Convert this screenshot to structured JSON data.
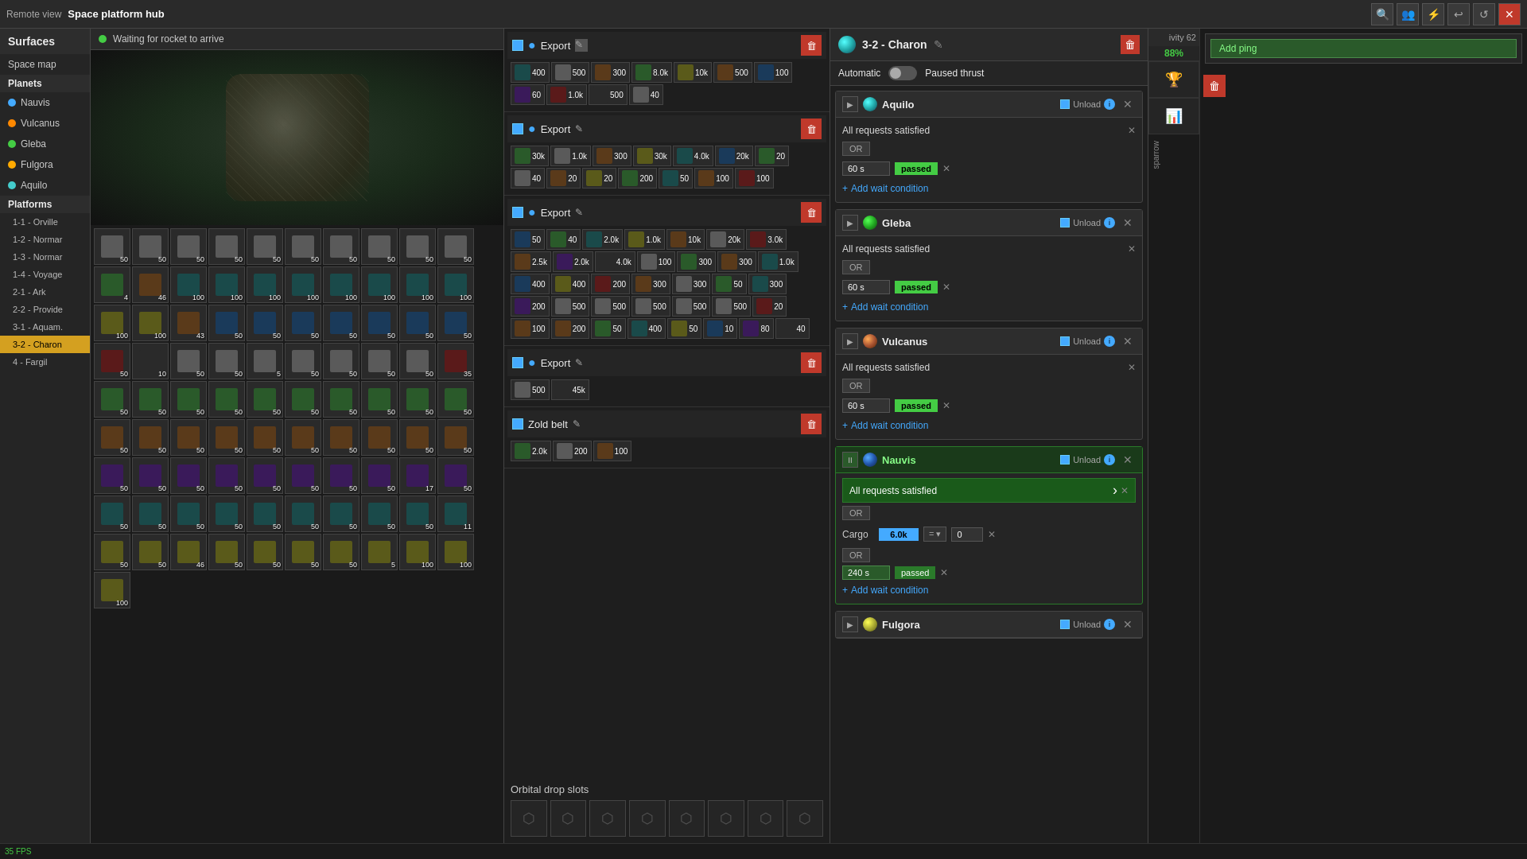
{
  "titleBar": {
    "remoteView": "Remote view",
    "title": "Space platform hub",
    "icons": [
      "🔍",
      "👥",
      "⚡",
      "↩",
      "✕"
    ]
  },
  "leftSidebar": {
    "surfacesLabel": "Surfaces",
    "spaceMapLabel": "Space map",
    "planetsLabel": "Planets",
    "planets": [
      {
        "name": "Nauvis",
        "dotClass": "dot-blue"
      },
      {
        "name": "Vulcanus",
        "dotClass": "dot-orange"
      },
      {
        "name": "Gleba",
        "dotClass": "dot-green"
      },
      {
        "name": "Fulgora",
        "dotClass": "dot-yellow"
      },
      {
        "name": "Aquilo",
        "dotClass": "dot-teal"
      }
    ],
    "platformsLabel": "Platforms",
    "platforms": [
      {
        "name": "1-1 - Orville",
        "active": false
      },
      {
        "name": "1-2 - Normar",
        "active": false
      },
      {
        "name": "1-3 - Normar",
        "active": false
      },
      {
        "name": "1-4 - Voyage",
        "active": false
      },
      {
        "name": "2-1 - Ark",
        "active": false
      },
      {
        "name": "2-2 - Provide",
        "active": false
      },
      {
        "name": "3-1 - Aquam.",
        "active": false
      },
      {
        "name": "3-2 - Charon",
        "active": true
      },
      {
        "name": "4 - Fargil",
        "active": false
      }
    ]
  },
  "gameView": {
    "waitingStatus": "Waiting for rocket to arrive"
  },
  "exportPanel": {
    "exports": [
      {
        "label": "Export",
        "items": [
          {
            "count": "400"
          },
          {
            "count": "500"
          },
          {
            "count": "300"
          },
          {
            "count": "8.0k"
          },
          {
            "count": "10k"
          },
          {
            "count": "500"
          },
          {
            "count": "100"
          },
          {
            "count": "60"
          },
          {
            "count": "1.0k"
          },
          {
            "count": "500"
          },
          {
            "count": "40"
          }
        ]
      },
      {
        "label": "Export",
        "items": [
          {
            "count": "30k"
          },
          {
            "count": "1.0k"
          },
          {
            "count": "300"
          },
          {
            "count": "30k"
          },
          {
            "count": "4.0k"
          },
          {
            "count": "20k"
          },
          {
            "count": "20"
          },
          {
            "count": "40"
          },
          {
            "count": "20"
          },
          {
            "count": "20"
          },
          {
            "count": "200"
          },
          {
            "count": "50"
          },
          {
            "count": "100"
          },
          {
            "count": "100"
          }
        ]
      },
      {
        "label": "Export",
        "items": [
          {
            "count": "50"
          },
          {
            "count": "40"
          },
          {
            "count": "2.0k"
          },
          {
            "count": "1.0k"
          },
          {
            "count": "10k"
          },
          {
            "count": "20k"
          },
          {
            "count": "3.0k"
          },
          {
            "count": "2.5k"
          },
          {
            "count": "2.0k"
          },
          {
            "count": "4.0k"
          },
          {
            "count": "100"
          },
          {
            "count": "300"
          },
          {
            "count": "300"
          },
          {
            "count": "1.0k"
          },
          {
            "count": "400"
          },
          {
            "count": "400"
          },
          {
            "count": "200"
          },
          {
            "count": "300"
          },
          {
            "count": "300"
          },
          {
            "count": "50"
          },
          {
            "count": "300"
          },
          {
            "count": "200"
          },
          {
            "count": "500"
          },
          {
            "count": "500"
          },
          {
            "count": "500"
          },
          {
            "count": "500"
          },
          {
            "count": "500"
          },
          {
            "count": "20"
          },
          {
            "count": "100"
          },
          {
            "count": "200"
          },
          {
            "count": "50"
          },
          {
            "count": "400"
          },
          {
            "count": "50"
          },
          {
            "count": "10"
          },
          {
            "count": "80"
          },
          {
            "count": "40"
          }
        ]
      },
      {
        "label": "Export",
        "items": [
          {
            "count": "500"
          },
          {
            "count": "45k"
          }
        ]
      },
      {
        "label": "Zold belt",
        "items": [
          {
            "count": "2.0k"
          },
          {
            "count": "200"
          },
          {
            "count": "100"
          }
        ]
      }
    ],
    "orbitalSlotsLabel": "Orbital drop slots"
  },
  "schedule": {
    "title": "3-2 - Charon",
    "autoLabel": "Automatic",
    "pausedLabel": "Paused thrust",
    "stops": [
      {
        "name": "Aquilo",
        "unloadLabel": "Unload",
        "conditions": [
          {
            "type": "allRequests",
            "label": "All requests satisfied"
          },
          {
            "type": "time",
            "seconds": "60 s",
            "status": "passed"
          }
        ],
        "addWaitLabel": "+ Add wait condition"
      },
      {
        "name": "Gleba",
        "unloadLabel": "Unload",
        "conditions": [
          {
            "type": "allRequests",
            "label": "All requests satisfied"
          },
          {
            "type": "time",
            "seconds": "60 s",
            "status": "passed"
          }
        ],
        "addWaitLabel": "+ Add wait condition"
      },
      {
        "name": "Vulcanus",
        "unloadLabel": "Unload",
        "conditions": [
          {
            "type": "allRequests",
            "label": "All requests satisfied"
          },
          {
            "type": "time",
            "seconds": "60 s",
            "status": "passed"
          }
        ],
        "addWaitLabel": "+ Add wait condition"
      },
      {
        "name": "Nauvis",
        "unloadLabel": "Unload",
        "active": true,
        "conditions": [
          {
            "type": "allRequestsActive",
            "label": "All requests satisfied"
          },
          {
            "type": "cargo",
            "cargoLabel": "Cargo",
            "cargoValue": "6.0k",
            "num": "0"
          },
          {
            "type": "timePassed",
            "seconds": "240 s",
            "status": "passed"
          }
        ],
        "addWaitLabel": "+ Add wait condition"
      },
      {
        "name": "Fulgora",
        "unloadLabel": "Unload"
      }
    ]
  },
  "sidePanel": {
    "addPingLabel": "Add ping",
    "activityLabel": "ivity 62",
    "percentLabel": "88%"
  },
  "bottomBar": {
    "fps": "35 FPS"
  }
}
